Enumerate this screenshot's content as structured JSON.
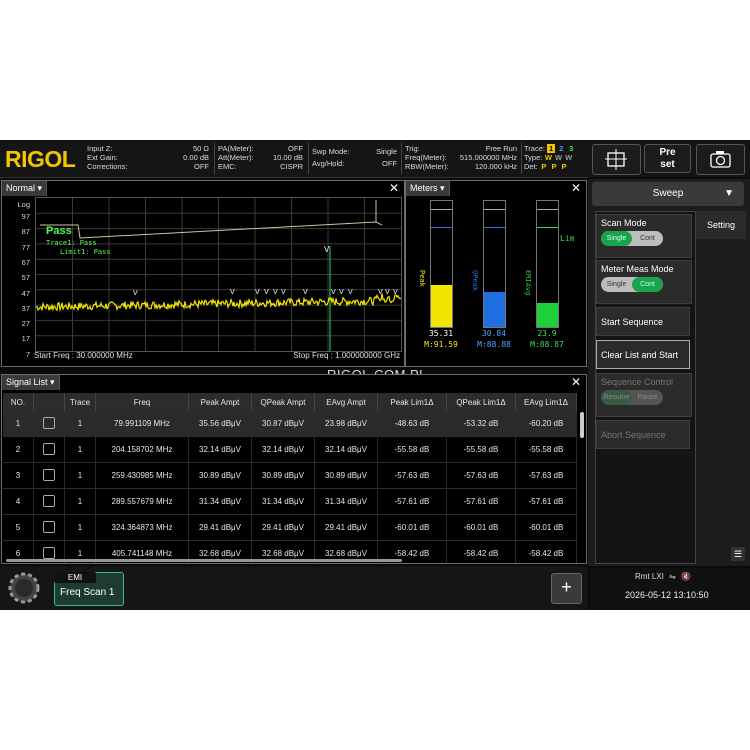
{
  "header": {
    "logo": "RIGOL",
    "col1": [
      {
        "label": "Input Z:",
        "value": "50 Ω"
      },
      {
        "label": "Ext Gain:",
        "value": "0.00 dB"
      },
      {
        "label": "Corrections:",
        "value": "OFF"
      }
    ],
    "col2": [
      {
        "label": "PA(Meter):",
        "value": "OFF"
      },
      {
        "label": "Att(Meter):",
        "value": "10.00 dB"
      },
      {
        "label": "EMC:",
        "value": "CISPR"
      }
    ],
    "col3": [
      {
        "label": "Swp Mode:",
        "value": "Single"
      },
      {
        "label": "Avg/Hold:",
        "value": "OFF"
      }
    ],
    "col4": [
      {
        "label": "Trig:",
        "value": "Free Run"
      },
      {
        "label": "Freq(Meter):",
        "value": "515.000000 MHz"
      },
      {
        "label": "RBW(Meter):",
        "value": "120.000 kHz"
      }
    ],
    "trace": {
      "label": "Trace:",
      "nums": [
        "1",
        "2",
        "3"
      ],
      "type_label": "Type:",
      "types": [
        "W",
        "W",
        "W"
      ],
      "det_label": "Det:",
      "dets": [
        "P",
        "P",
        "P"
      ]
    }
  },
  "top_buttons": {
    "preset": "Pre set"
  },
  "normal_panel": {
    "title": "Normal",
    "unit": "Log",
    "y_ticks": [
      "97",
      "87",
      "77",
      "67",
      "57",
      "47",
      "37",
      "27",
      "17",
      "7"
    ],
    "pass": "Pass",
    "trace1": "Trace1: Pass",
    "limit1": "Limit1: Pass",
    "start": "Start Freq : 30.000000 MHz",
    "stop": "Stop Freq : 1.000000000 GHz"
  },
  "meters_panel": {
    "title": "Meters",
    "bars": [
      {
        "name": "Peak",
        "value": "35.31",
        "max": "M:91.59",
        "color": "#f2e600",
        "level": 0.33
      },
      {
        "name": "QPeak",
        "value": "30.84",
        "max": "M:88.88",
        "color": "#1e6fe0",
        "level": 0.28
      },
      {
        "name": "EMIAvg",
        "value": "23.9",
        "max": "M:88.87",
        "color": "#1fcf3a",
        "level": 0.19
      }
    ],
    "lim": "Lim"
  },
  "watermark": "RIGOL.COM.PL",
  "signal_list": {
    "title": "Signal List",
    "columns": [
      "NO.",
      "",
      "Trace",
      "Freq",
      "Peak Ampt",
      "QPeak Ampt",
      "EAvg Ampt",
      "Peak Lim1Δ",
      "QPeak Lim1Δ",
      "EAvg Lim1Δ"
    ],
    "rows": [
      [
        "1",
        "",
        "1",
        "79.991109 MHz",
        "35.56 dBμV",
        "30.87 dBμV",
        "23.98 dBμV",
        "-48.63 dB",
        "-53.32 dB",
        "-60.20 dB"
      ],
      [
        "2",
        "",
        "1",
        "204.158702 MHz",
        "32.14 dBμV",
        "32.14 dBμV",
        "32.14 dBμV",
        "-55.58 dB",
        "-55.58 dB",
        "-55.58 dB"
      ],
      [
        "3",
        "",
        "1",
        "259.430985 MHz",
        "30.89 dBμV",
        "30.89 dBμV",
        "30.89 dBμV",
        "-57.63 dB",
        "-57.63 dB",
        "-57.63 dB"
      ],
      [
        "4",
        "",
        "1",
        "289.557679 MHz",
        "31.34 dBμV",
        "31.34 dBμV",
        "31.34 dBμV",
        "-57.61 dB",
        "-57.61 dB",
        "-57.61 dB"
      ],
      [
        "5",
        "",
        "1",
        "324.364873 MHz",
        "29.41 dBμV",
        "29.41 dBμV",
        "29.41 dBμV",
        "-60.01 dB",
        "-60.01 dB",
        "-60.01 dB"
      ],
      [
        "6",
        "",
        "1",
        "405.741148 MHz",
        "32.68 dBμV",
        "32.68 dBμV",
        "32.68 dBμV",
        "-58.42 dB",
        "-58.42 dB",
        "-58.42 dB"
      ]
    ]
  },
  "sidebar": {
    "mode": "Sweep",
    "tab": "Setting",
    "scan_mode": "Scan Mode",
    "scan_opts": [
      "Single",
      "Cont"
    ],
    "meter_mode": "Meter Meas Mode",
    "meter_opts": [
      "Single",
      "Cont"
    ],
    "start_seq": "Start Sequence",
    "clear_start": "Clear List and Start",
    "seq_control": "Sequence Control",
    "seq_opts": [
      "Resume",
      "Pause"
    ],
    "abort_seq": "Abort Sequence"
  },
  "bottom": {
    "emi_tab": "EMI",
    "scan_tab": "Freq Scan 1",
    "plus": "+"
  },
  "status": {
    "icons": "Rmt LXI",
    "datetime": "2026-05-12 13:10:50"
  },
  "colors": {
    "accent": "#f1c500",
    "pass": "#4cff4c",
    "trace": "#f2e600",
    "limit": "#c8c8a0"
  }
}
